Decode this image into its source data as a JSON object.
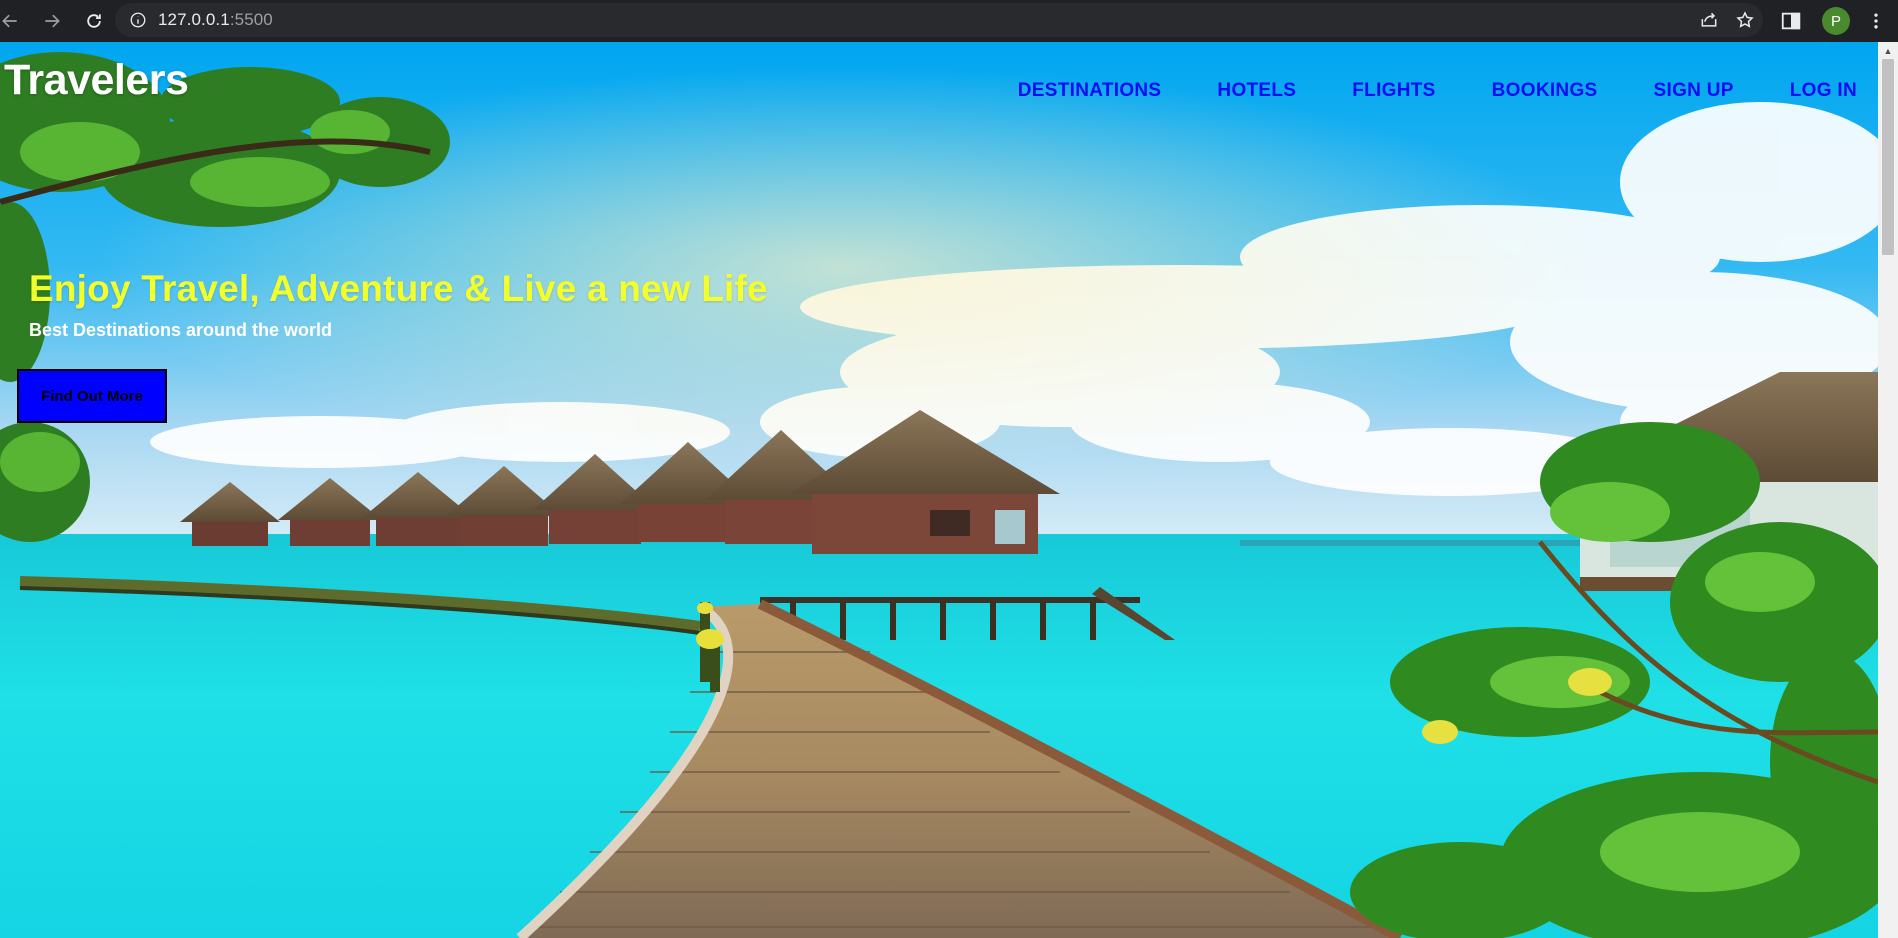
{
  "browser": {
    "url_host": "127.0.0.1",
    "url_port": ":5500",
    "profile_initial": "P"
  },
  "site": {
    "logo": "Travelers",
    "nav": {
      "destinations": "DESTINATIONS",
      "hotels": "HOTELS",
      "flights": "FLIGHTS",
      "bookings": "BOOKINGS",
      "signup": "SIGN UP",
      "login": "LOG IN"
    },
    "hero": {
      "title": "Enjoy Travel, Adventure & Live a new Life",
      "subtitle": "Best Destinations around the world",
      "cta": "Find Out More"
    }
  },
  "colors": {
    "nav_link": "#0c0cf5",
    "hero_title": "#f3ff2a",
    "cta_background": "#0000ff",
    "chrome_background": "#202124"
  },
  "icons": [
    "back-icon",
    "forward-icon",
    "reload-icon",
    "site-info-icon",
    "share-icon",
    "bookmark-star-icon",
    "side-panel-icon",
    "more-menu-icon"
  ]
}
